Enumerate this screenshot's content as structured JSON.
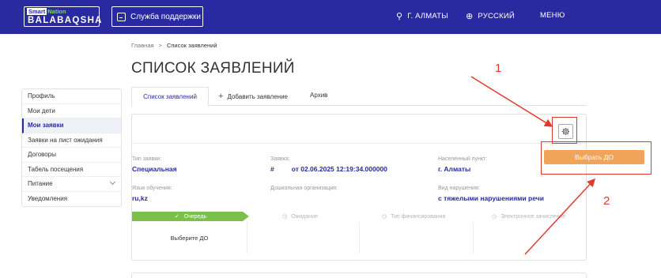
{
  "header": {
    "logo_small_1": "Smart",
    "logo_small_2": "Nation",
    "logo_main": "BALABAQSHA",
    "support_label": "Служба поддержки",
    "city": "Г. АЛМАТЫ",
    "language": "РУССКИЙ",
    "menu": "МЕНЮ",
    "colors": {
      "bar": "#2a2aa0",
      "accent_green": "#7ed957"
    }
  },
  "breadcrumb": {
    "home": "Главная",
    "sep": ">",
    "current": "Список заявлений"
  },
  "page_title": "СПИСОК ЗАЯВЛЕНИЙ",
  "sidebar": {
    "items": [
      {
        "label": "Профиль"
      },
      {
        "label": "Мои дети"
      },
      {
        "label": "Мои заявки"
      },
      {
        "label": "Заявки на лист ожидания"
      },
      {
        "label": "Договоры"
      },
      {
        "label": "Табель посещения"
      },
      {
        "label": "Питание"
      },
      {
        "label": "Уведомления"
      }
    ],
    "active": "Мои заявки"
  },
  "tabs": [
    {
      "label": "Список заявлений"
    },
    {
      "label": "Добавить заявление",
      "icon": "+"
    },
    {
      "label": "Архив"
    }
  ],
  "card": {
    "fields": {
      "type_label": "Тип заявки:",
      "type_value": "Специальная",
      "app_label": "Заявка:",
      "app_hash": "#",
      "app_date": "от 02.06.2025 12:19:34.000000",
      "city_label": "Населенный пункт:",
      "city_value": "г. Алматы",
      "lang_label": "Язык обучения:",
      "lang_value": "ru,kz",
      "org_label": "Дошкольная организация:",
      "violation_label": "Вид нарушения:",
      "violation_value": "с тяжелыми нарушениями речи"
    },
    "choose_button": "Выбрать ДО",
    "steps": [
      {
        "icon": "✓",
        "label": "Очередь"
      },
      {
        "icon": "◷",
        "label": "Ожидание"
      },
      {
        "icon": "◷",
        "label": "Тип финансирования"
      },
      {
        "icon": "◷",
        "label": "Электронное зачисление"
      }
    ],
    "grid_first_cell": "Выберите ДО",
    "colors": {
      "step_active": "#7cc04b",
      "button": "#f0a45a",
      "value_text": "#2a2aa0"
    }
  },
  "annotations": {
    "marker_1": "1",
    "marker_2": "2",
    "color": "#e23b2b"
  }
}
